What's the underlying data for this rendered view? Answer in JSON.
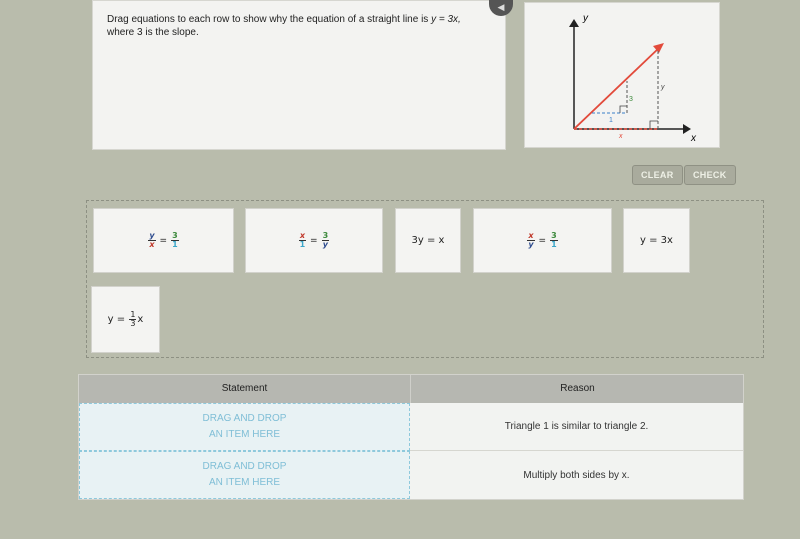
{
  "prompt": {
    "line1_prefix": "Drag equations to each row to show why the equation of a straight line is ",
    "line1_eq": "y = 3x,",
    "line2": "where 3 is the slope."
  },
  "audio": {
    "icon": "speaker-icon",
    "glyph": "◀"
  },
  "graph": {
    "y_axis_label": "y",
    "x_axis_label": "x",
    "small_rise_label": "3",
    "small_run_label": "1",
    "big_rise_label": "y",
    "big_run_label": "x",
    "colors": {
      "line": "#e24a3b",
      "axes": "#222222",
      "rise_small": "#3c8a3c",
      "run_small": "#3a7fc9"
    }
  },
  "buttons": {
    "clear": "CLEAR",
    "check": "CHECK"
  },
  "tiles": [
    {
      "id": "y-over-x-eq-3-over-1",
      "lhs_num": "y",
      "lhs_den": "x",
      "rhs_num": "3",
      "rhs_den": "1"
    },
    {
      "id": "x-over-1-eq-3-over-y",
      "lhs_num": "x",
      "lhs_den": "1",
      "rhs_num": "3",
      "rhs_den": "y"
    },
    {
      "id": "3y-eq-x",
      "text": "3y = x"
    },
    {
      "id": "x-over-y-eq-3-over-1",
      "lhs_num": "x",
      "lhs_den": "y",
      "rhs_num": "3",
      "rhs_den": "1"
    },
    {
      "id": "y-eq-3x",
      "text": "y = 3x"
    },
    {
      "id": "y-eq-third-x",
      "prefix": "y = ",
      "frac_num": "1",
      "frac_den": "3",
      "suffix": "x"
    }
  ],
  "table": {
    "headers": {
      "statement": "Statement",
      "reason": "Reason"
    },
    "rows": [
      {
        "drop_line1": "DRAG AND DROP",
        "drop_line2": "AN ITEM HERE",
        "reason": "Triangle 1 is similar to triangle 2."
      },
      {
        "drop_line1": "DRAG AND DROP",
        "drop_line2": "AN ITEM HERE",
        "reason": "Multiply both sides by x."
      }
    ]
  }
}
